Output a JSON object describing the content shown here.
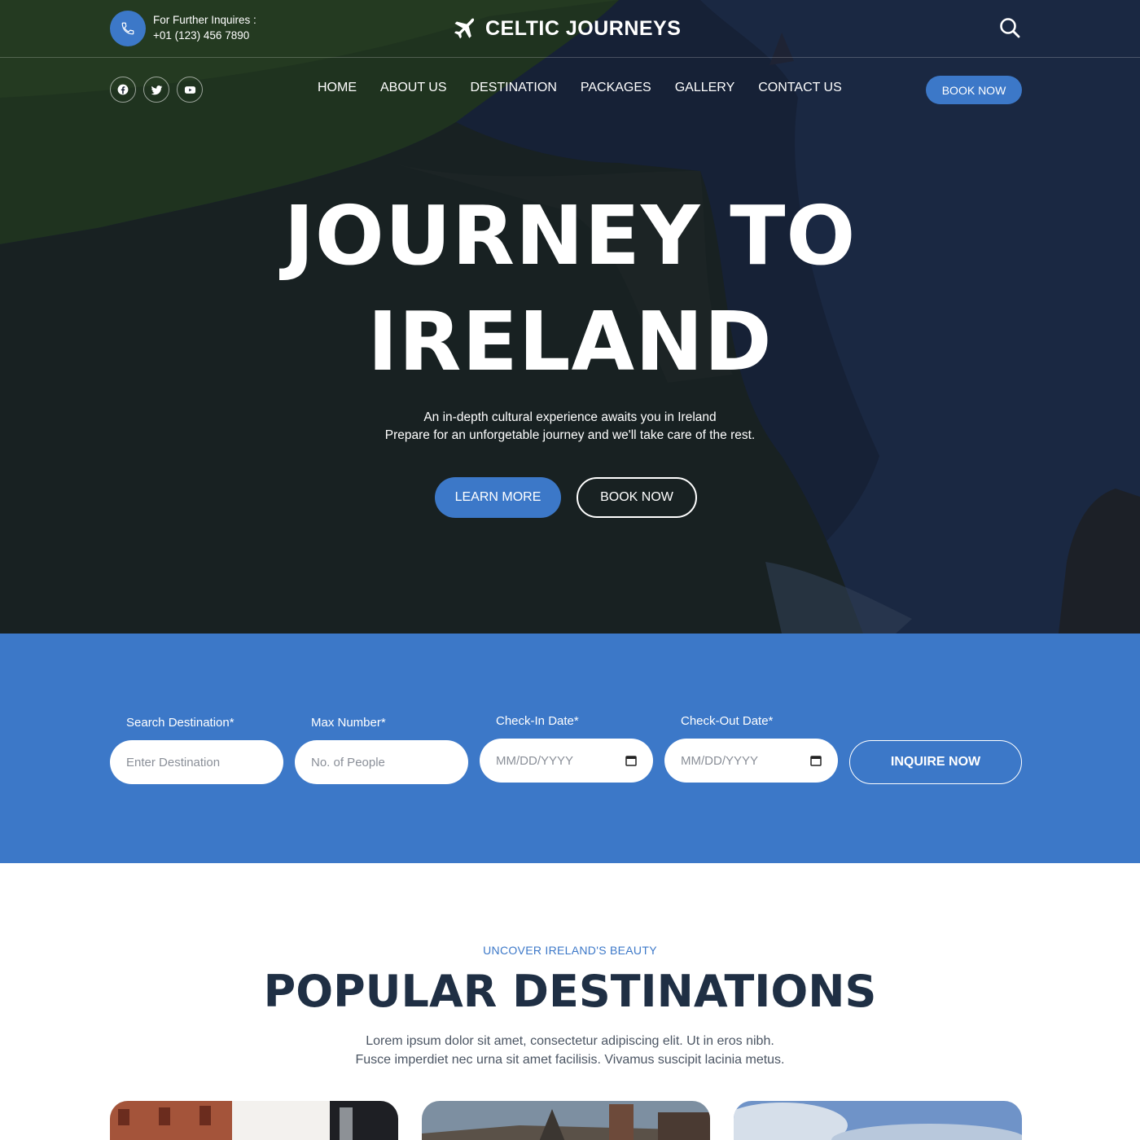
{
  "header": {
    "inquiry_label": "For Further Inquires :",
    "phone": "+01 (123) 456 7890",
    "brand": "CELTIC JOURNEYS",
    "icons": {
      "phone": "phone-icon",
      "plane": "airplane-icon",
      "search": "search-icon"
    }
  },
  "social": [
    "facebook-icon",
    "twitter-icon",
    "youtube-icon"
  ],
  "nav": {
    "items": [
      {
        "label": "HOME"
      },
      {
        "label": "ABOUT US"
      },
      {
        "label": "DESTINATION"
      },
      {
        "label": "PACKAGES"
      },
      {
        "label": "GALLERY"
      },
      {
        "label": "CONTACT US"
      }
    ],
    "book_label": "BOOK NOW"
  },
  "hero": {
    "line1": "JOURNEY TO",
    "line2": "IRELAND",
    "sub1": "An in-depth cultural experience awaits you in Ireland",
    "sub2": "Prepare for an unforgetable journey and we'll take care of the rest.",
    "learn_more": "LEARN MORE",
    "book_now": "BOOK NOW"
  },
  "search": {
    "destination_label": "Search Destination*",
    "destination_placeholder": "Enter Destination",
    "max_label": "Max Number*",
    "max_placeholder": "No. of People",
    "checkin_label": "Check-In Date*",
    "checkin_placeholder": "MM/DD/YYYY",
    "checkout_label": "Check-Out Date*",
    "checkout_placeholder": "MM/DD/YYYY",
    "inquire_label": "INQUIRE NOW"
  },
  "destinations": {
    "eyebrow": "UNCOVER IRELAND'S BEAUTY",
    "title": "POPULAR DESTINATIONS",
    "desc1": "Lorem ipsum dolor sit amet, consectetur adipiscing elit. Ut in eros nibh.",
    "desc2": "Fusce imperdiet nec urna sit amet facilisis. Vivamus suscipit lacinia metus."
  },
  "colors": {
    "accent": "#3c78c8",
    "heading": "#1f2f44",
    "white": "#ffffff"
  }
}
